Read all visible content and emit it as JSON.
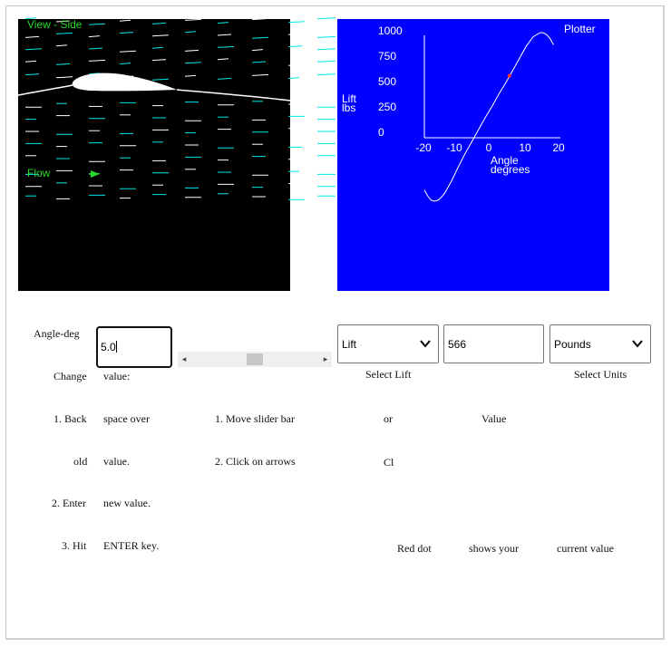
{
  "side_view": {
    "title": "View - Side",
    "flow_label": "Flow",
    "colors": {
      "background": "#000000",
      "text": "#27d627",
      "streamline_white": "#ffffff",
      "streamline_cyan": "#00e5e5"
    }
  },
  "plotter": {
    "title": "Plotter",
    "y_label_line1": "Lift",
    "y_label_line2": "lbs",
    "x_label_line1": "Angle",
    "x_label_line2": "degrees",
    "background": "#0000ff",
    "current_point_color": "#ff3030"
  },
  "chart_data": {
    "type": "line",
    "title": "Plotter",
    "xlabel": "Angle degrees",
    "ylabel": "Lift lbs",
    "xlim": [
      -20,
      20
    ],
    "ylim": [
      -750,
      1000
    ],
    "x_ticks": [
      "-20",
      "-10",
      "0",
      "10",
      "20"
    ],
    "y_ticks": [
      "1000",
      "750",
      "500",
      "250",
      "0"
    ],
    "grid": false,
    "series": [
      {
        "x": [
          -20,
          -19,
          -18,
          -17,
          -16,
          -15,
          -14,
          -12,
          -10,
          -8,
          -6,
          -4,
          -2,
          0,
          2,
          4,
          6,
          8,
          10,
          12,
          14,
          15,
          16,
          17,
          18
        ],
        "values": [
          -560,
          -620,
          -660,
          -670,
          -660,
          -630,
          -590,
          -470,
          -330,
          -200,
          -80,
          40,
          160,
          270,
          390,
          500,
          620,
          740,
          860,
          950,
          990,
          990,
          970,
          930,
          870
        ]
      }
    ],
    "current_point": {
      "x": 5.0,
      "y": 566
    }
  },
  "controls": {
    "angle_label": "Angle-deg",
    "angle_value": "5.0",
    "lift_select": "Lift",
    "lift_value": "566",
    "units_select": "Pounds",
    "select_lift_label": "Select Lift",
    "select_units_label": "Select Units"
  },
  "instructions": {
    "change": "Change",
    "value_colon": "value:",
    "step1_a": "1. Back",
    "step1_b": "space over",
    "old": "old",
    "value_dot": "value.",
    "step2_a": "2. Enter",
    "step2_b": "new value.",
    "step3_a": "3. Hit",
    "step3_b": "ENTER key.",
    "slider1": "1. Move slider bar",
    "slider2": "2. Click on arrows",
    "or": "or",
    "cl": "Cl",
    "value": "Value",
    "red_dot": "Red dot",
    "shows_your": "shows your",
    "current_value": "current value"
  }
}
